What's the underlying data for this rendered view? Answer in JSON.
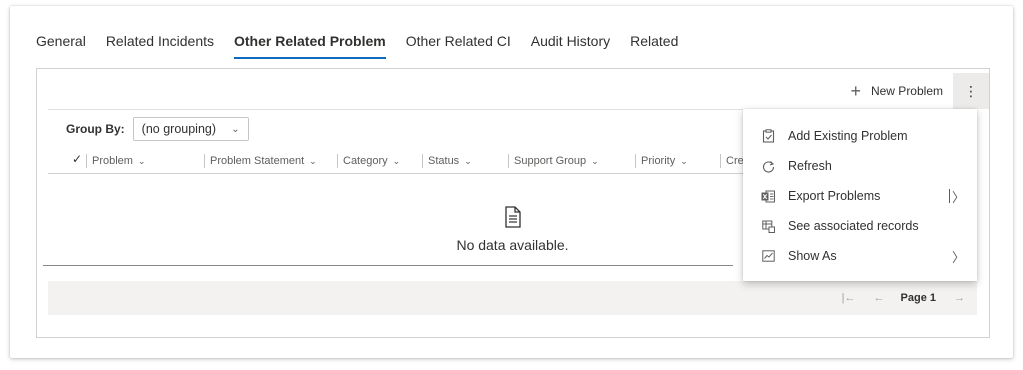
{
  "tabs": [
    {
      "label": "General"
    },
    {
      "label": "Related Incidents"
    },
    {
      "label": "Other Related Problem"
    },
    {
      "label": "Other Related CI"
    },
    {
      "label": "Audit History"
    },
    {
      "label": "Related"
    }
  ],
  "active_tab": "Other Related Problem",
  "command_bar": {
    "new_label": "New Problem",
    "more_label": "⋮"
  },
  "group_by": {
    "label": "Group By:",
    "value": "(no grouping)"
  },
  "columns": [
    {
      "label": "Problem"
    },
    {
      "label": "Problem Statement"
    },
    {
      "label": "Category"
    },
    {
      "label": "Status"
    },
    {
      "label": "Support Group"
    },
    {
      "label": "Priority"
    },
    {
      "label": "Cre"
    }
  ],
  "empty_state": {
    "text": "No data available.",
    "icon": "document-icon"
  },
  "pager": {
    "page_label": "Page 1"
  },
  "menu": {
    "items": [
      {
        "label": "Add Existing Problem",
        "icon": "clipboard-add-icon"
      },
      {
        "label": "Refresh",
        "icon": "refresh-icon"
      },
      {
        "label": "Export Problems",
        "icon": "excel-icon"
      },
      {
        "label": "See associated records",
        "icon": "associated-records-icon"
      },
      {
        "label": "Show As",
        "icon": "chart-view-icon"
      }
    ]
  },
  "colors": {
    "accent": "#0f6cbd",
    "border": "#d1d1d1",
    "footer_bg": "#f3f2f1"
  }
}
